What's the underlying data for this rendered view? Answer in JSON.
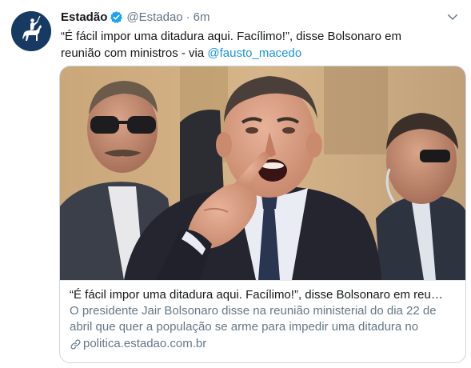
{
  "tweet": {
    "display_name": "Estadão",
    "handle": "@Estadao",
    "separator": "·",
    "time": "6m",
    "text_main": "“É fácil impor uma ditadura aqui. Facílimo!”, disse Bolsonaro em reunião com ministros - via ",
    "mention": "@fausto_macedo"
  },
  "card": {
    "title": "“É fácil impor uma ditadura aqui. Facílimo!”, disse Bolsonaro em reu…",
    "description": "O presidente Jair Bolsonaro disse na reunião ministerial do dia 22 de abril que quer a população se arme para impedir uma ditadura no",
    "domain": "politica.estadao.com.br"
  },
  "colors": {
    "accent": "#1da1f2",
    "mention": "#1b95e0",
    "secondary_text": "#657786",
    "avatar_bg": "#173a63"
  },
  "icons": [
    "horse-rider-logo",
    "verified-badge-icon",
    "chevron-down-icon",
    "link-icon"
  ]
}
